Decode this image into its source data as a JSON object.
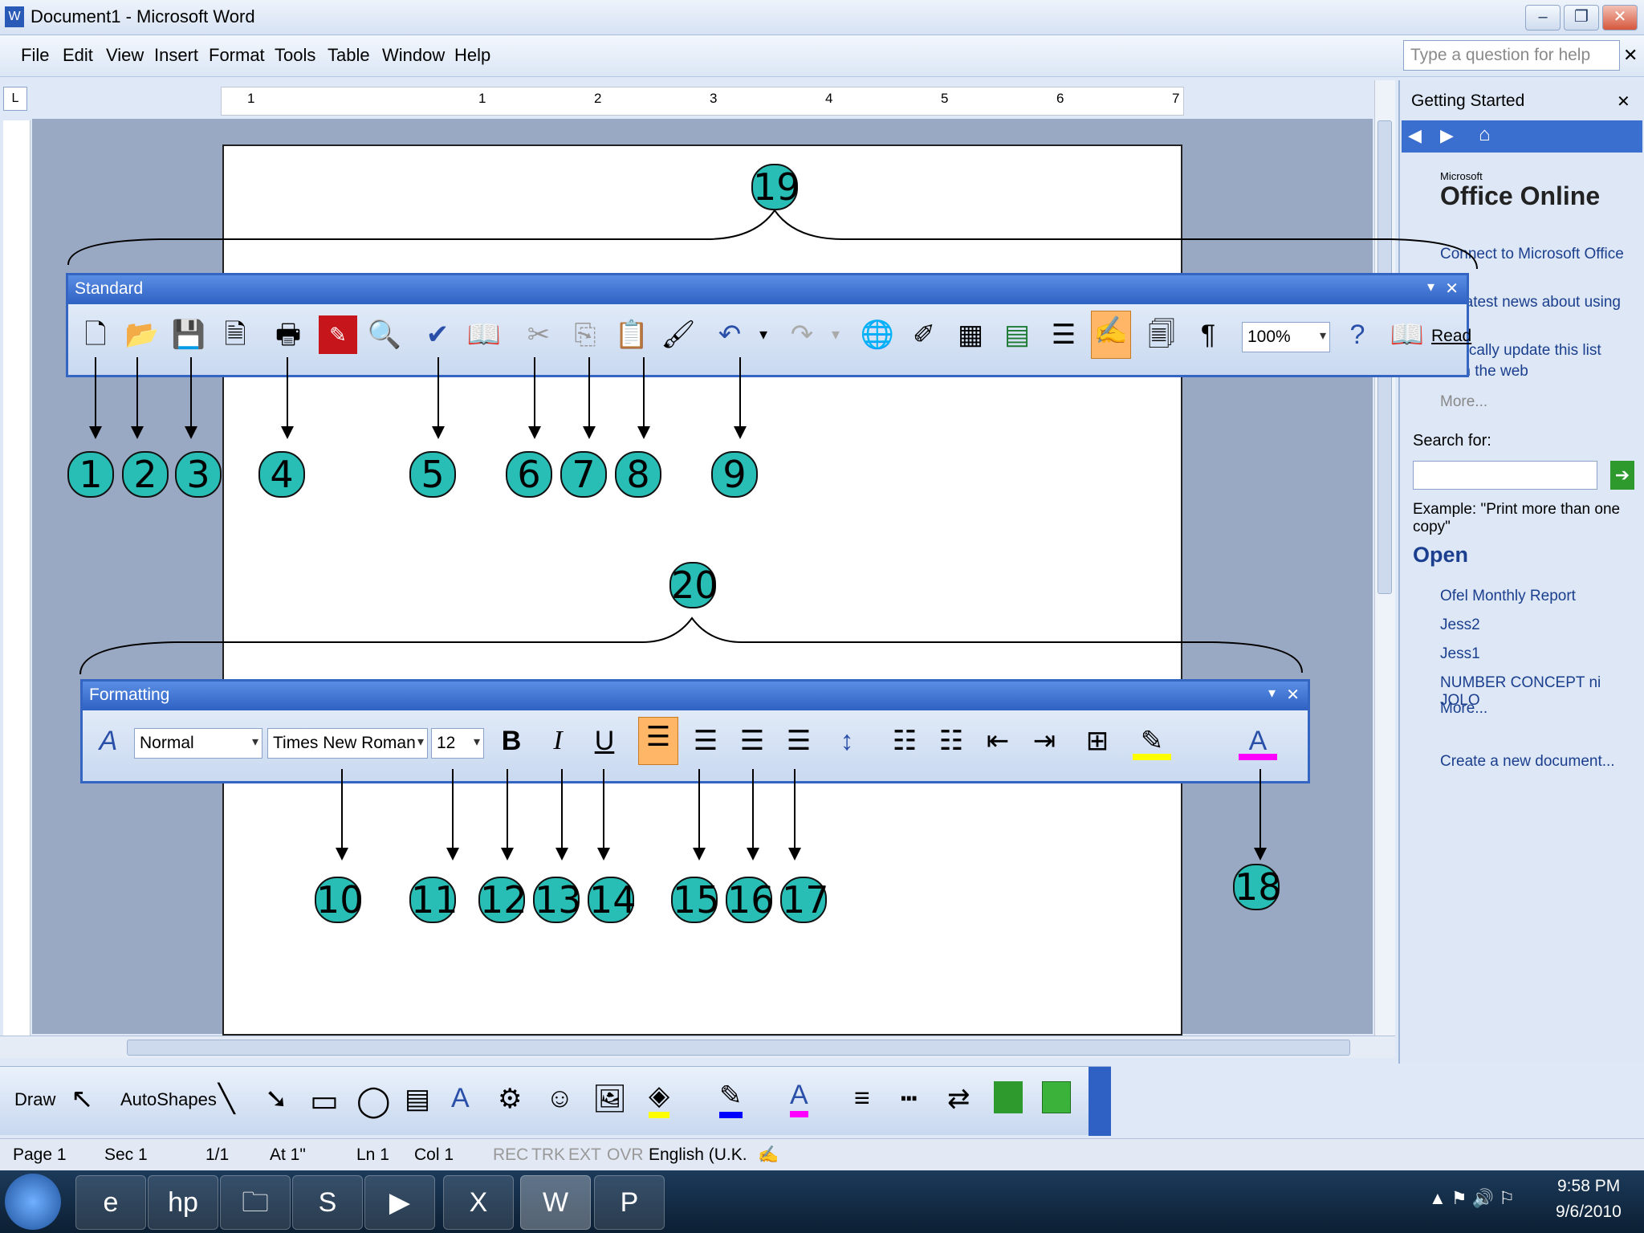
{
  "window": {
    "title": "Document1 - Microsoft Word"
  },
  "menu": [
    "File",
    "Edit",
    "View",
    "Insert",
    "Format",
    "Tools",
    "Table",
    "Window",
    "Help"
  ],
  "help_placeholder": "Type a question for help",
  "ruler_numbers": [
    "1",
    "1",
    "2",
    "3",
    "4",
    "5",
    "6",
    "7"
  ],
  "task_pane": {
    "title": "Getting Started",
    "logo": "Office Online",
    "logo_small": "Microsoft",
    "links": [
      "Connect to Microsoft Office",
      "he latest news about using",
      "matically update this list",
      "from the web",
      "More..."
    ],
    "search_label": "Search for:",
    "example": "Example: \"Print more than one copy\"",
    "open_title": "Open",
    "recent": [
      "Ofel Monthly Report",
      "Jess2",
      "Jess1",
      "NUMBER CONCEPT ni JOLO"
    ],
    "more": "More...",
    "create": "Create a new document..."
  },
  "standard": {
    "title": "Standard",
    "zoom": "100%",
    "read": "Read"
  },
  "formatting": {
    "title": "Formatting",
    "style": "Normal",
    "font": "Times New Roman",
    "size": "12"
  },
  "labels": {
    "n1": "1",
    "n2": "2",
    "n3": "3",
    "n4": "4",
    "n5": "5",
    "n6": "6",
    "n7": "7",
    "n8": "8",
    "n9": "9",
    "n10": "10",
    "n11": "11",
    "n12": "12",
    "n13": "13",
    "n14": "14",
    "n15": "15",
    "n16": "16",
    "n17": "17",
    "n18": "18",
    "n19": "19",
    "n20": "20"
  },
  "draw": {
    "draw": "Draw",
    "autoshapes": "AutoShapes"
  },
  "status": {
    "page": "Page 1",
    "sec": "Sec 1",
    "pages": "1/1",
    "at": "At 1\"",
    "ln": "Ln 1",
    "col": "Col 1",
    "rec": "REC",
    "trk": "TRK",
    "ext": "EXT",
    "ovr": "OVR",
    "lang": "English (U.K."
  },
  "clock": {
    "time": "9:58 PM",
    "date": "9/6/2010"
  }
}
